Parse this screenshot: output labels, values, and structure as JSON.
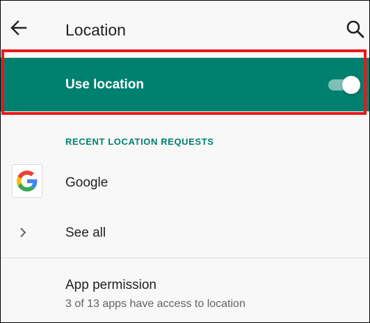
{
  "app_bar": {
    "title": "Location",
    "back_icon": "arrow-back-icon",
    "search_icon": "search-icon"
  },
  "master_switch": {
    "label": "Use location",
    "state": "on",
    "background_color": "#00806e"
  },
  "recent_requests": {
    "header": "RECENT LOCATION REQUESTS",
    "items": [
      {
        "label": "Google",
        "icon": "google-logo-icon"
      }
    ],
    "see_all": {
      "label": "See all",
      "icon": "chevron-right-icon"
    }
  },
  "app_permission": {
    "title": "App permission",
    "summary": "3 of 13 apps have access to location"
  },
  "colors": {
    "accent": "#00806e",
    "highlight": "#e8191b"
  }
}
